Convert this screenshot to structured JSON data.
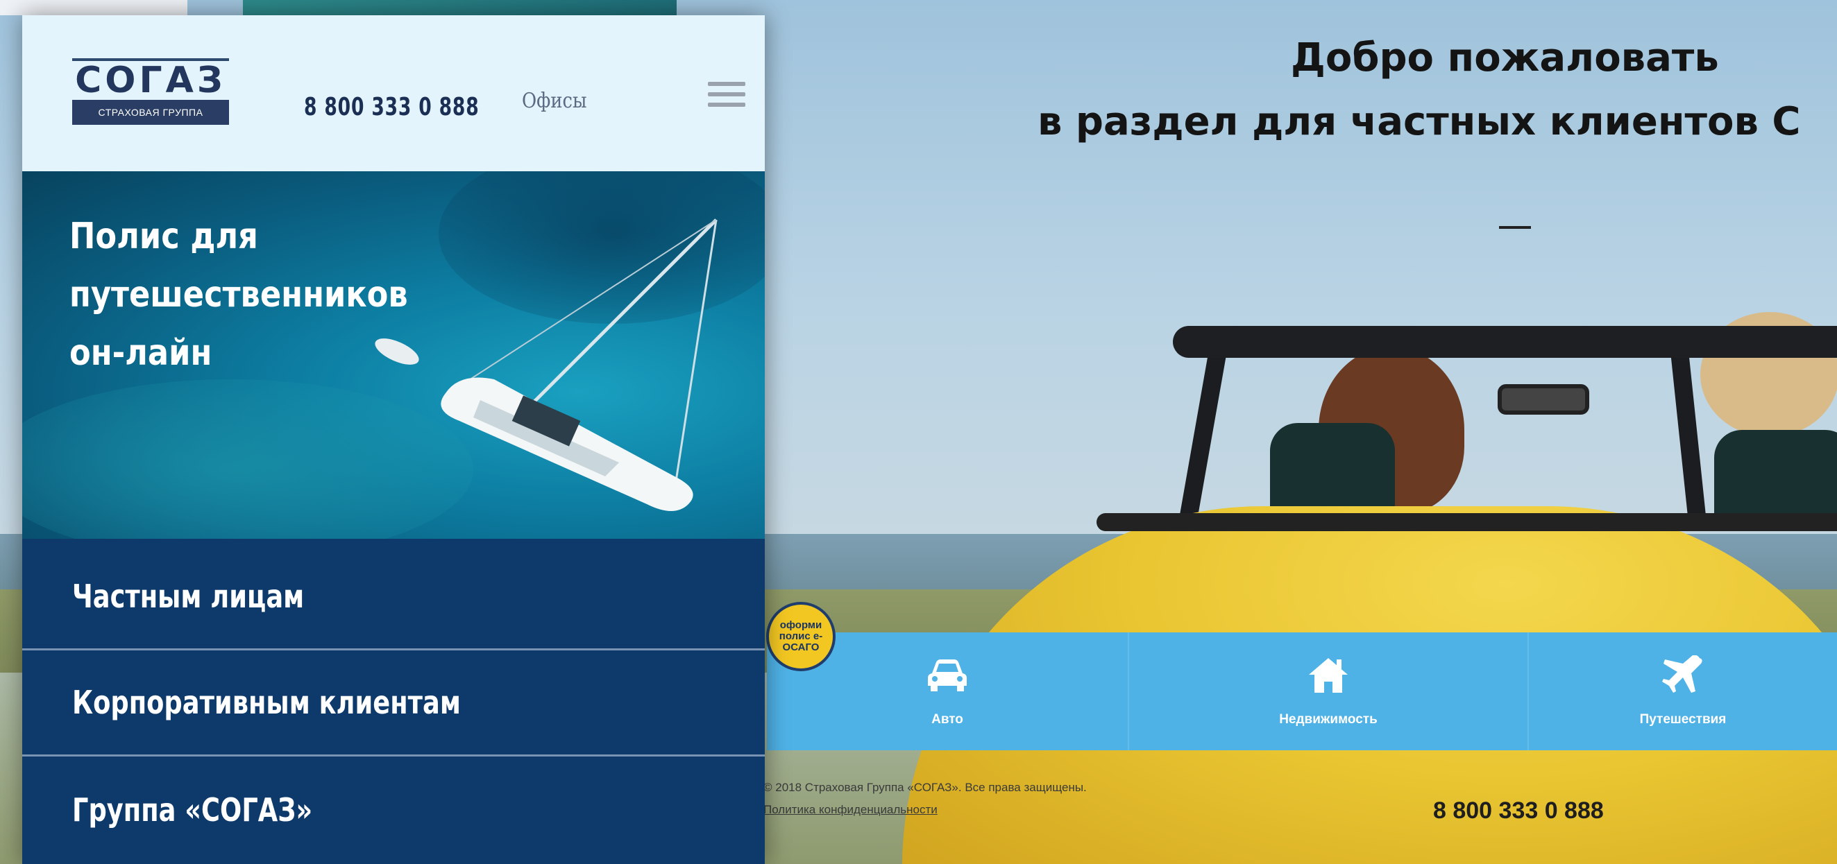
{
  "background_page": {
    "hero_title_line1": "Добро пожаловать",
    "hero_title_line2": "в раздел для частных клиентов С",
    "osago_badge": "оформи полис е-ОСАГО",
    "categories": [
      {
        "label": "Авто",
        "icon": "car-icon"
      },
      {
        "label": "Недвижимость",
        "icon": "house-icon"
      },
      {
        "label": "Путешествия",
        "icon": "airplane-icon"
      }
    ],
    "footer_copyright": "© 2018 Страховая Группа «СОГАЗ». Все права защищены.",
    "footer_policy_link": "Политика конфиденциальности",
    "footer_phone": "8 800 333 0 888"
  },
  "mobile": {
    "logo": {
      "name": "СОГАЗ",
      "tagline": "СТРАХОВАЯ ГРУППА"
    },
    "header_phone": "8 800 333 0 888",
    "offices_link": "Офисы",
    "menu_icon": "hamburger-menu-icon",
    "banner_title_line1": "Полис для путешественников",
    "banner_title_line2": "он-лайн",
    "nav_items": [
      {
        "label": "Частным лицам"
      },
      {
        "label": "Корпоративным клиентам"
      },
      {
        "label": "Группа «СОГАЗ»"
      }
    ]
  },
  "colors": {
    "brand_navy": "#0e3a6b",
    "header_bg": "#e3f4fc",
    "category_bar": "#4fb2e6",
    "badge_yellow": "#f3c722"
  }
}
